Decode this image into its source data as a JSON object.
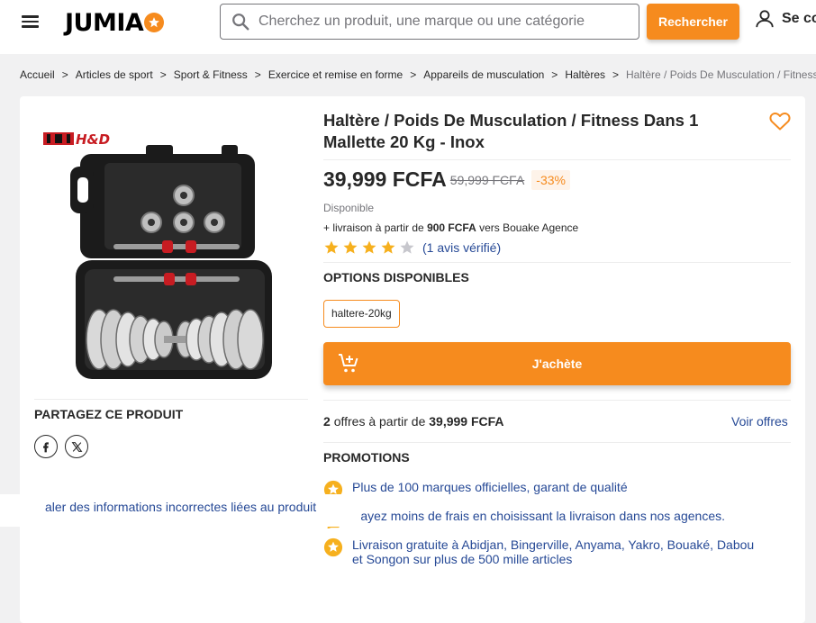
{
  "header": {
    "logo_text": "JUMIA",
    "search_placeholder": "Cherchez un produit, une marque ou une catégorie",
    "search_button": "Rechercher",
    "account_label": "Se co"
  },
  "breadcrumb": [
    "Accueil",
    "Articles de sport",
    "Sport & Fitness",
    "Exercice et remise en forme",
    "Appareils de musculation",
    "Haltères",
    "Haltère / Poids De Musculation / Fitness"
  ],
  "breadcrumb_separator": ">",
  "product": {
    "image_logo": "H&D",
    "title": "Haltère / Poids De Musculation / Fitness Dans 1 Mallette 20 Kg - Inox",
    "price": "39,999 FCFA",
    "old_price": "59,999 FCFA",
    "discount": "-33%",
    "stock": "Disponible",
    "delivery_prefix": "+ livraison à partir de",
    "delivery_amount": "900 FCFA",
    "delivery_suffix": "vers Bouake Agence",
    "rating": 4,
    "rating_max": 5,
    "reviews": "(1 avis vérifié)"
  },
  "share": {
    "title": "PARTAGEZ CE PRODUIT",
    "icons": [
      "facebook-icon",
      "x-icon"
    ]
  },
  "report_link": "aler des informations incorrectes liées au produit",
  "options": {
    "title": "OPTIONS DISPONIBLES",
    "variant": "haltere-20kg"
  },
  "buy_button": "J'achète",
  "offers": {
    "count": "2",
    "text": "offres à partir de",
    "price": "39,999 FCFA",
    "link": "Voir offres"
  },
  "promotions": {
    "title": "PROMOTIONS",
    "items": [
      "Plus de 100 marques officielles, garant de qualité",
      "Payez moins de frais en choisissant la livraison dans nos agences.",
      "Livraison gratuite à Abidjan, Bingerville, Anyama, Yakro, Bouaké, Dabou et Songon sur plus de 500 mille articles"
    ]
  },
  "colors": {
    "accent": "#f68b1e",
    "link": "#264996",
    "text": "#282828",
    "muted": "#75757a",
    "background": "#f1f1f2"
  }
}
